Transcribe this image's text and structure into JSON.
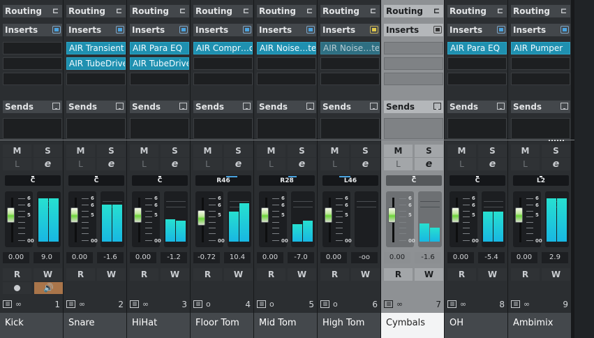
{
  "labels": {
    "routing": "Routing",
    "inserts": "Inserts",
    "sends": "Sends",
    "mute": "M",
    "solo": "S",
    "listen": "L",
    "edit": "e",
    "read": "R",
    "write": "W",
    "fader_scale": [
      "6",
      "6",
      "5",
      "00"
    ],
    "keyboard_icon_text": "▥",
    "monitor_icon_text": "🔊"
  },
  "colors": {
    "insert_active": "#1f90b0",
    "meter": "#27e0d0",
    "selected_channel": "#8e9194",
    "monitor_active": "#a9754a"
  },
  "channels": [
    {
      "number": "1",
      "name": "Kick",
      "inserts": [],
      "pan": "C",
      "volume": "0.00",
      "peak": "9.0",
      "fader_level": 0.78,
      "meter_levels": [
        0.86,
        0.86
      ],
      "link_icon": "∞",
      "insert_icon": "blue",
      "has_rec_monitor": true,
      "selected": false
    },
    {
      "number": "2",
      "name": "Snare",
      "inserts": [
        "AIR Transient",
        "AIR TubeDrive"
      ],
      "pan": "C",
      "volume": "0.00",
      "peak": "-1.6",
      "fader_level": 0.78,
      "meter_levels": [
        0.73,
        0.73
      ],
      "link_icon": "∞",
      "insert_icon": "blue",
      "has_rec_monitor": false,
      "selected": false
    },
    {
      "number": "3",
      "name": "HiHat",
      "inserts": [
        "AIR Para EQ",
        "AIR TubeDrive"
      ],
      "pan": "C",
      "volume": "0.00",
      "peak": "-1.2",
      "fader_level": 0.78,
      "meter_levels": [
        0.44,
        0.41
      ],
      "link_icon": "∞",
      "insert_icon": "blue",
      "has_rec_monitor": false,
      "selected": false
    },
    {
      "number": "4",
      "name": "Floor Tom",
      "inserts": [
        "AIR Compr…or"
      ],
      "pan": "R46",
      "pan_mark": [
        0.55,
        0.2
      ],
      "volume": "-0.72",
      "peak": "10.4",
      "fader_level": 0.72,
      "meter_levels": [
        0.6,
        0.76
      ],
      "link_icon": "o",
      "insert_icon": "blue",
      "has_rec_monitor": false,
      "selected": false
    },
    {
      "number": "5",
      "name": "Mid Tom",
      "inserts": [
        "AIR Noise…te"
      ],
      "pan": "R28",
      "pan_mark": [
        0.52,
        0.15
      ],
      "volume": "0.00",
      "peak": "-7.0",
      "fader_level": 0.78,
      "meter_levels": [
        0.35,
        0.42
      ],
      "link_icon": "o",
      "insert_icon": "blue",
      "has_rec_monitor": false,
      "selected": false
    },
    {
      "number": "6",
      "name": "High Tom",
      "inserts": [
        "AIR Noise…te"
      ],
      "inserts_bypassed": true,
      "pan": "L46",
      "pan_mark": [
        0.3,
        0.2
      ],
      "volume": "0.00",
      "peak": "-oo",
      "fader_level": 0.78,
      "meter_levels": [
        0,
        0
      ],
      "link_icon": "o",
      "insert_icon": "yellow",
      "has_rec_monitor": false,
      "selected": false
    },
    {
      "number": "7",
      "name": "Cymbals",
      "inserts": [],
      "pan": "C",
      "volume": "0.00",
      "peak": "-1.6",
      "fader_level": 0.78,
      "meter_levels": [
        0.36,
        0.28
      ],
      "link_icon": "∞",
      "insert_icon": "dark",
      "has_rec_monitor": false,
      "selected": true
    },
    {
      "number": "8",
      "name": "OH",
      "inserts": [
        "AIR Para EQ"
      ],
      "pan": "C",
      "volume": "0.00",
      "peak": "-5.4",
      "fader_level": 0.78,
      "meter_levels": [
        0.6,
        0.6
      ],
      "link_icon": "∞",
      "insert_icon": "blue",
      "has_rec_monitor": false,
      "selected": false
    },
    {
      "number": "9",
      "name": "Ambimix",
      "inserts": [
        "AIR Pumper"
      ],
      "pan": "L2",
      "volume": "0.00",
      "peak": "2.9",
      "fader_level": 0.78,
      "meter_levels": [
        0.86,
        0.86
      ],
      "link_icon": "∞",
      "insert_icon": "blue",
      "has_rec_monitor": false,
      "selected": false
    }
  ]
}
